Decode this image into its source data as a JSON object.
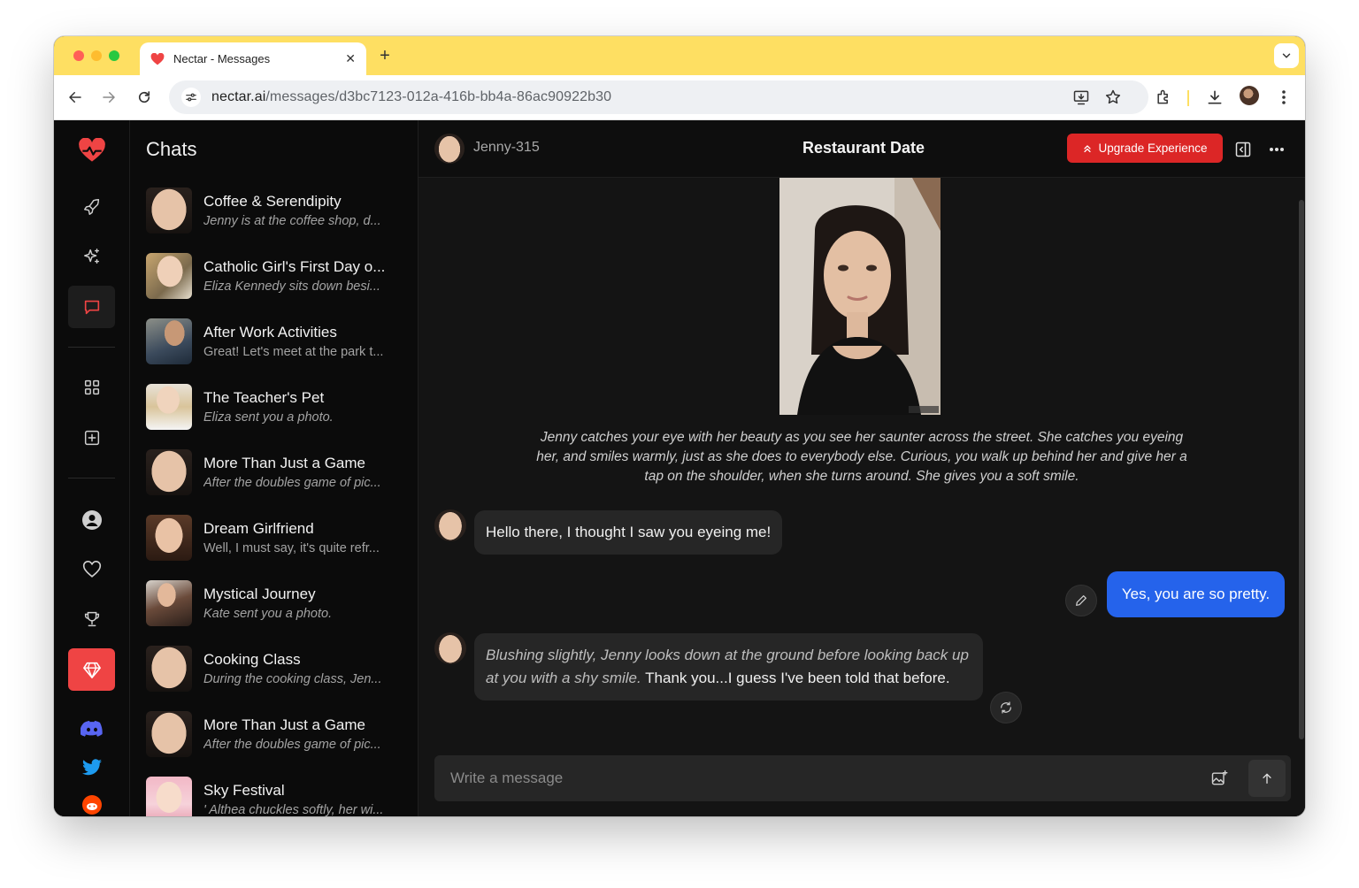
{
  "browser": {
    "tab_title": "Nectar - Messages",
    "new_tab": "+",
    "close_tab": "✕",
    "url_host": "nectar.ai",
    "url_path": "/messages/d3bc7123-012a-416b-bb4a-86ac90922b30"
  },
  "sidebar": {
    "items": [
      {
        "icon": "heart-pulse-icon"
      },
      {
        "icon": "rocket-icon"
      },
      {
        "icon": "sparkles-icon"
      },
      {
        "icon": "chat-bubble-icon",
        "active": true
      },
      {
        "icon": "grid-icon"
      },
      {
        "icon": "plus-square-icon"
      },
      {
        "icon": "user-icon"
      },
      {
        "icon": "heart-icon"
      },
      {
        "icon": "trophy-icon"
      },
      {
        "icon": "diamond-icon",
        "highlight": "#ef4444"
      },
      {
        "icon": "discord-icon",
        "color": "#5865f2"
      },
      {
        "icon": "twitter-icon",
        "color": "#1d9bf0"
      },
      {
        "icon": "reddit-icon",
        "color": "#ff4500"
      }
    ]
  },
  "chats": {
    "title": "Chats",
    "items": [
      {
        "name": "Coffee & Serendipity",
        "preview": "Jenny is at the coffee shop, d...",
        "italic": true
      },
      {
        "name": "Catholic Girl's First Day o...",
        "preview": "Eliza Kennedy sits down besi...",
        "italic": true
      },
      {
        "name": "After Work Activities",
        "preview": "Great! Let's meet at the park t...",
        "italic": false
      },
      {
        "name": "The Teacher's Pet",
        "preview": "Eliza sent you a photo.",
        "italic": true
      },
      {
        "name": "More Than Just a Game",
        "preview": "After the doubles game of pic...",
        "italic": true
      },
      {
        "name": "Dream Girlfriend",
        "preview": "Well, I must say, it's quite refr...",
        "italic": false
      },
      {
        "name": "Mystical Journey",
        "preview": "Kate sent you a photo.",
        "italic": true
      },
      {
        "name": "Cooking Class",
        "preview": "During the cooking class, Jen...",
        "italic": true
      },
      {
        "name": "More Than Just a Game",
        "preview": "After the doubles game of pic...",
        "italic": true
      },
      {
        "name": "Sky Festival",
        "preview": "' Althea chuckles softly, her wi...",
        "italic": true
      }
    ]
  },
  "conversation": {
    "character": "Jenny-315",
    "title": "Restaurant Date",
    "upgrade_label": "Upgrade Experience",
    "narration": "Jenny catches your eye with her beauty as you see her saunter across the street. She catches you eyeing her, and smiles warmly, just as she does to everybody else. Curious, you walk up behind her and give her a tap on the shoulder, when she turns around. She gives you a soft smile.",
    "messages": [
      {
        "from": "character",
        "text": "Hello there, I thought I saw you eyeing me!"
      },
      {
        "from": "user",
        "text": "Yes, you are so pretty."
      },
      {
        "from": "character",
        "action": "Blushing slightly, Jenny looks down at the ground before looking back up at you with a shy smile.",
        "text": " Thank you...I guess I've been told that before."
      }
    ],
    "composer_placeholder": "Write a message"
  },
  "colors": {
    "accent": "#ef4444",
    "user_bubble": "#2563eb",
    "tabstrip": "#fedf62"
  }
}
